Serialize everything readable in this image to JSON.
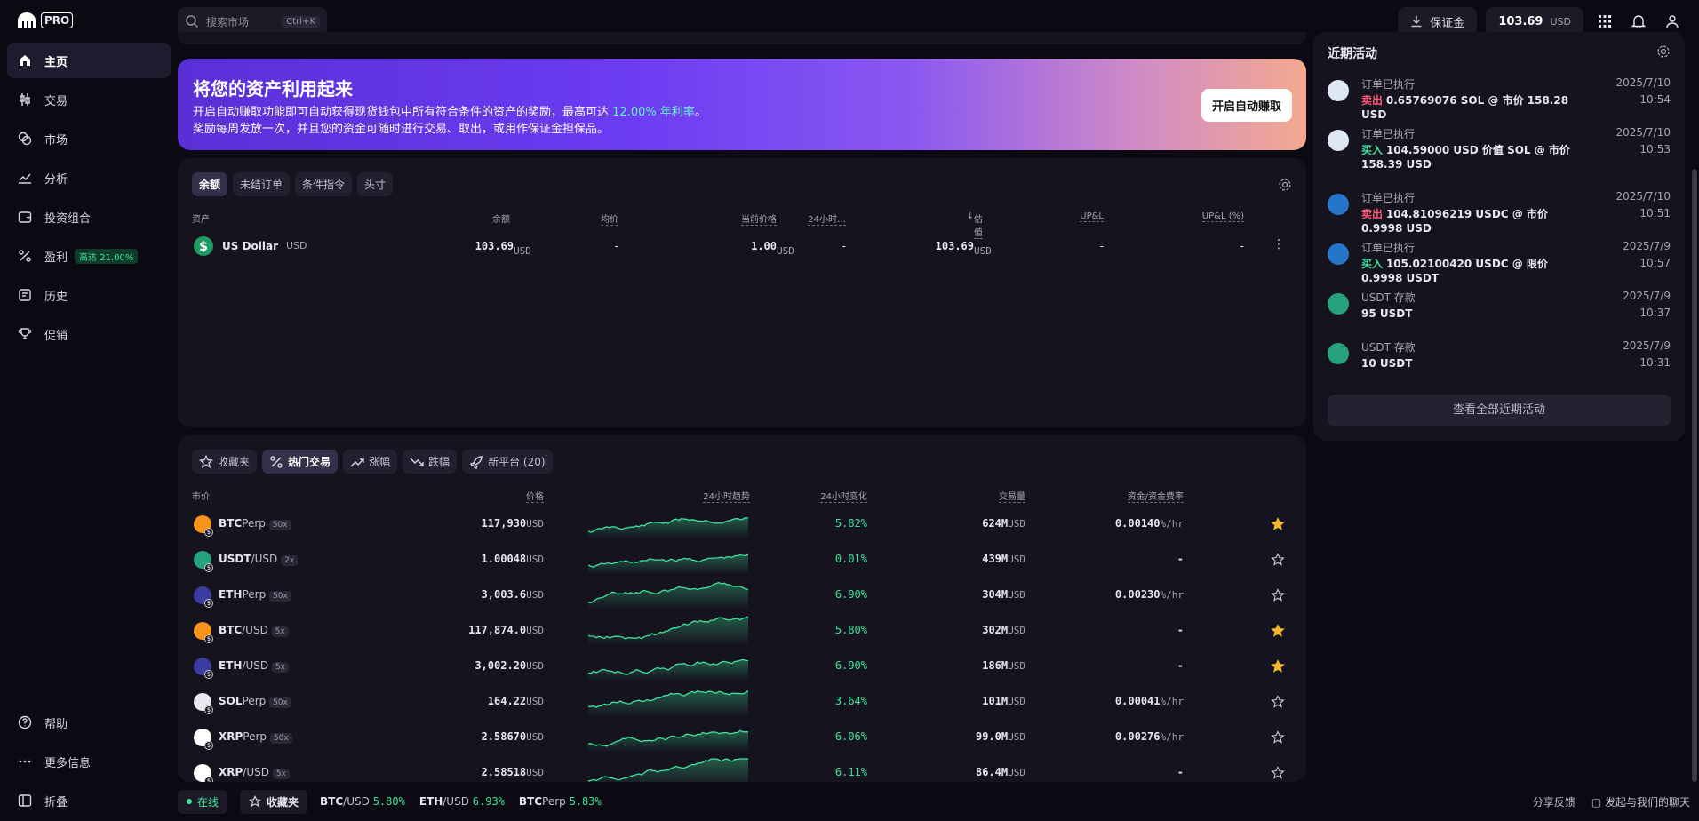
{
  "app": {
    "logo_text": "PRO"
  },
  "colors": {
    "accent": "#6b3cf3",
    "positive": "#3fe39b",
    "negative": "#ff5472",
    "background": "#0b0a12",
    "panel": "#15131e"
  },
  "nav": {
    "items": [
      {
        "label": "主页",
        "icon": "home-icon"
      },
      {
        "label": "交易",
        "icon": "trade-icon"
      },
      {
        "label": "市场",
        "icon": "market-icon"
      },
      {
        "label": "分析",
        "icon": "chart-icon"
      },
      {
        "label": "投资组合",
        "icon": "wallet-icon"
      },
      {
        "label": "盈利",
        "icon": "percent-icon",
        "badge": "高达 21.00%"
      },
      {
        "label": "历史",
        "icon": "history-icon"
      },
      {
        "label": "促销",
        "icon": "trophy-icon"
      }
    ],
    "bottom": [
      {
        "label": "帮助",
        "icon": "help-icon"
      },
      {
        "label": "更多信息",
        "icon": "more-icon"
      },
      {
        "label": "折叠",
        "icon": "collapse-icon"
      }
    ]
  },
  "search": {
    "placeholder": "搜索市场",
    "shortcut": "Ctrl+K"
  },
  "header": {
    "margin_label": "保证金",
    "balance_value": "103.69",
    "balance_unit": "USD"
  },
  "banner": {
    "title": "将您的资产利用起来",
    "line1_a": "开启自动赚取功能即可自动获得现货钱包中所有符合条件的资产的奖励，最高可达 ",
    "line1_rate": "12.00% 年利率",
    "line1_b": "。",
    "line2": "奖励每周发放一次，并且您的资金可随时进行交易、取出，或用作保证金担保品。",
    "button": "开启自动赚取"
  },
  "balances": {
    "tabs": [
      "余额",
      "未结订单",
      "条件指令",
      "头寸"
    ],
    "columns": [
      "资产",
      "余额",
      "均价",
      "当前价格",
      "24小时…",
      "估值",
      "UP&L",
      "UP&L (%)"
    ],
    "rows": [
      {
        "name": "US Dollar",
        "code": "USD",
        "balance": "103.69",
        "balance_unit": "USD",
        "avg": "-",
        "price": "1.00",
        "price_unit": "USD",
        "change": "-",
        "value": "103.69",
        "value_unit": "USD",
        "upl": "-",
        "upl_pct": "-"
      }
    ]
  },
  "markets": {
    "tabs": [
      {
        "label": "收藏夹",
        "icon": "star-icon"
      },
      {
        "label": "热门交易",
        "icon": "percent-icon"
      },
      {
        "label": "涨幅",
        "icon": "trend-up-icon"
      },
      {
        "label": "跌幅",
        "icon": "trend-down-icon"
      },
      {
        "label": "新平台 (20)",
        "icon": "rocket-icon"
      }
    ],
    "columns": [
      "市价",
      "价格",
      "24小时趋势",
      "24小时变化",
      "交易量",
      "资金/资金费率"
    ],
    "rows": [
      {
        "base": "BTC",
        "quote": "Perp",
        "lev": "50x",
        "color": "#f7931a",
        "price": "117,930",
        "unit": "USD",
        "change": "5.82%",
        "volume": "624M",
        "vol_unit": "USD",
        "funding": "0.00140",
        "funding_unit": "%/hr",
        "fav": true
      },
      {
        "base": "USDT",
        "quote": "/USD",
        "lev": "2x",
        "color": "#26a17b",
        "price": "1.00048",
        "unit": "USD",
        "change": "0.01%",
        "volume": "439M",
        "vol_unit": "USD",
        "funding": "-",
        "funding_unit": "",
        "fav": false
      },
      {
        "base": "ETH",
        "quote": "Perp",
        "lev": "50x",
        "color": "#3c3ca0",
        "price": "3,003.6",
        "unit": "USD",
        "change": "6.90%",
        "volume": "304M",
        "vol_unit": "USD",
        "funding": "0.00230",
        "funding_unit": "%/hr",
        "fav": false
      },
      {
        "base": "BTC",
        "quote": "/USD",
        "lev": "5x",
        "color": "#f7931a",
        "price": "117,874.0",
        "unit": "USD",
        "change": "5.80%",
        "volume": "302M",
        "vol_unit": "USD",
        "funding": "-",
        "funding_unit": "",
        "fav": true
      },
      {
        "base": "ETH",
        "quote": "/USD",
        "lev": "5x",
        "color": "#3c3ca0",
        "price": "3,002.20",
        "unit": "USD",
        "change": "6.90%",
        "volume": "186M",
        "vol_unit": "USD",
        "funding": "-",
        "funding_unit": "",
        "fav": true
      },
      {
        "base": "SOL",
        "quote": "Perp",
        "lev": "50x",
        "color": "#e8e8f0",
        "price": "164.22",
        "unit": "USD",
        "change": "3.64%",
        "volume": "101M",
        "vol_unit": "USD",
        "funding": "0.00041",
        "funding_unit": "%/hr",
        "fav": false
      },
      {
        "base": "XRP",
        "quote": "Perp",
        "lev": "50x",
        "color": "#ffffff",
        "price": "2.58670",
        "unit": "USD",
        "change": "6.06%",
        "volume": "99.0M",
        "vol_unit": "USD",
        "funding": "0.00276",
        "funding_unit": "%/hr",
        "fav": false
      },
      {
        "base": "XRP",
        "quote": "/USD",
        "lev": "5x",
        "color": "#ffffff",
        "price": "2.58518",
        "unit": "USD",
        "change": "6.11%",
        "volume": "86.4M",
        "vol_unit": "USD",
        "funding": "-",
        "funding_unit": "",
        "fav": false
      }
    ]
  },
  "activity": {
    "title": "近期活动",
    "items": [
      {
        "title": "订单已执行",
        "side": "卖出",
        "side_type": "sell",
        "text": "0.65769076 SOL @ 市价 158.28 USD",
        "date": "2025/7/10",
        "time": "10:54",
        "icon_color": "#dfe7f5"
      },
      {
        "title": "订单已执行",
        "side": "买入",
        "side_type": "buy",
        "text": "104.59000 USD 价值 SOL @ 市价 158.39 USD",
        "date": "2025/7/10",
        "time": "10:53",
        "icon_color": "#dfe7f5"
      },
      {
        "title": "订单已执行",
        "side": "卖出",
        "side_type": "sell",
        "text": "104.81096219 USDC @ 市价 0.9998 USD",
        "date": "2025/7/10",
        "time": "10:51",
        "icon_color": "#2775ca"
      },
      {
        "title": "订单已执行",
        "side": "买入",
        "side_type": "buy",
        "text": "105.02100420 USDC @ 限价 0.9998 USDT",
        "date": "2025/7/9",
        "time": "10:57",
        "icon_color": "#2775ca"
      },
      {
        "title": "USDT 存款",
        "side": "",
        "side_type": "",
        "text": "95 USDT",
        "date": "2025/7/9",
        "time": "10:37",
        "icon_color": "#26a17b"
      },
      {
        "title": "USDT 存款",
        "side": "",
        "side_type": "",
        "text": "10 USDT",
        "date": "2025/7/9",
        "time": "10:31",
        "icon_color": "#26a17b"
      }
    ],
    "view_all": "查看全部近期活动"
  },
  "statusbar": {
    "online": "在线",
    "favorites": "收藏夹",
    "tickers": [
      {
        "base": "BTC",
        "quote": "/USD",
        "change": "5.80%"
      },
      {
        "base": "ETH",
        "quote": "/USD",
        "change": "6.93%"
      },
      {
        "base": "BTC",
        "quote": "Perp",
        "change": "5.83%"
      }
    ],
    "feedback": "分享反馈",
    "chat": "发起与我们的聊天"
  }
}
